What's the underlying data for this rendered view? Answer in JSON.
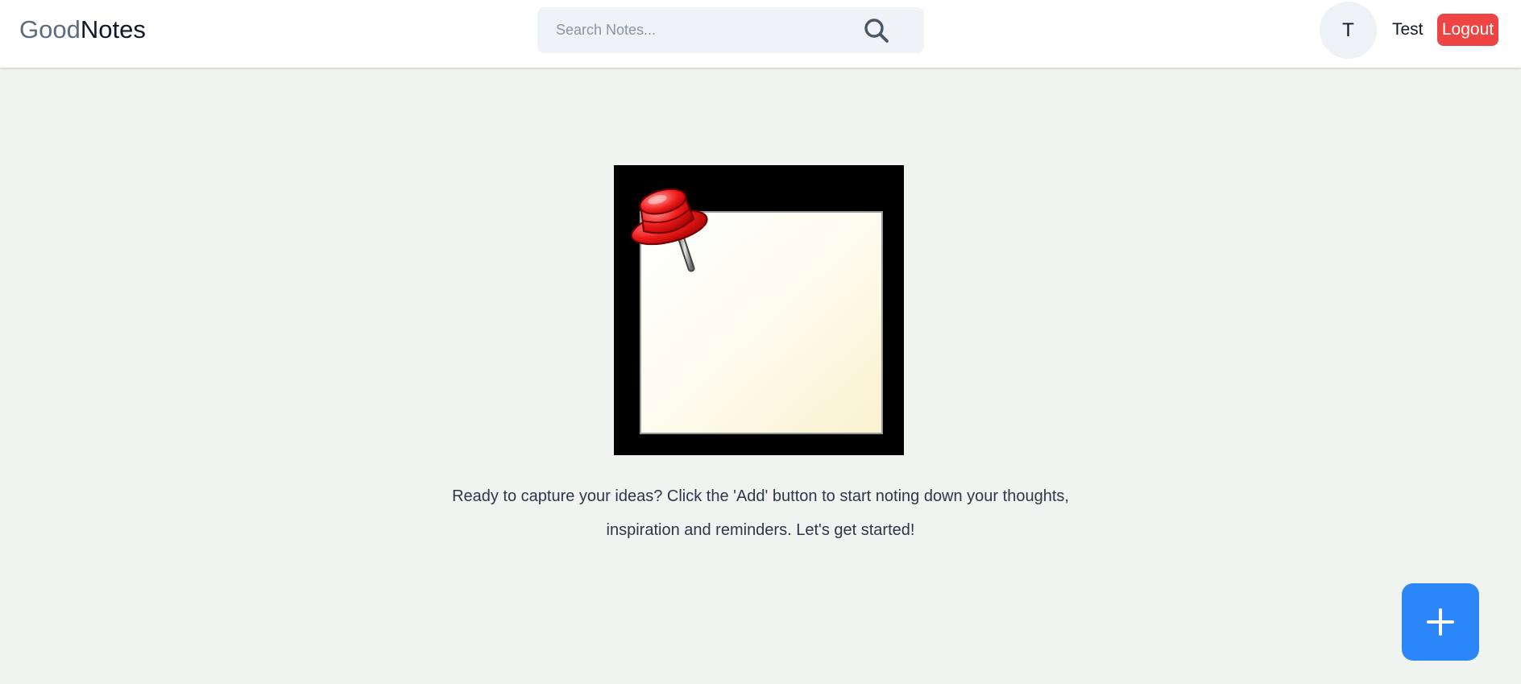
{
  "app": {
    "logo_part1": "Good",
    "logo_part2": "Notes"
  },
  "search": {
    "placeholder": "Search Notes...",
    "value": "",
    "icon": "search-icon"
  },
  "user": {
    "avatar_initial": "T",
    "name": "Test",
    "logout_label": "Logout"
  },
  "empty_state": {
    "image": "sticky-note-pushpin",
    "message": "Ready to capture your ideas? Click the 'Add' button to start noting down your thoughts, inspiration and reminders. Let's get started!"
  },
  "fab": {
    "icon": "plus-icon"
  },
  "colors": {
    "background": "#eff4f0",
    "accent": "#2b87f7",
    "danger": "#ef4444",
    "logo_secondary": "#5d6b82"
  }
}
